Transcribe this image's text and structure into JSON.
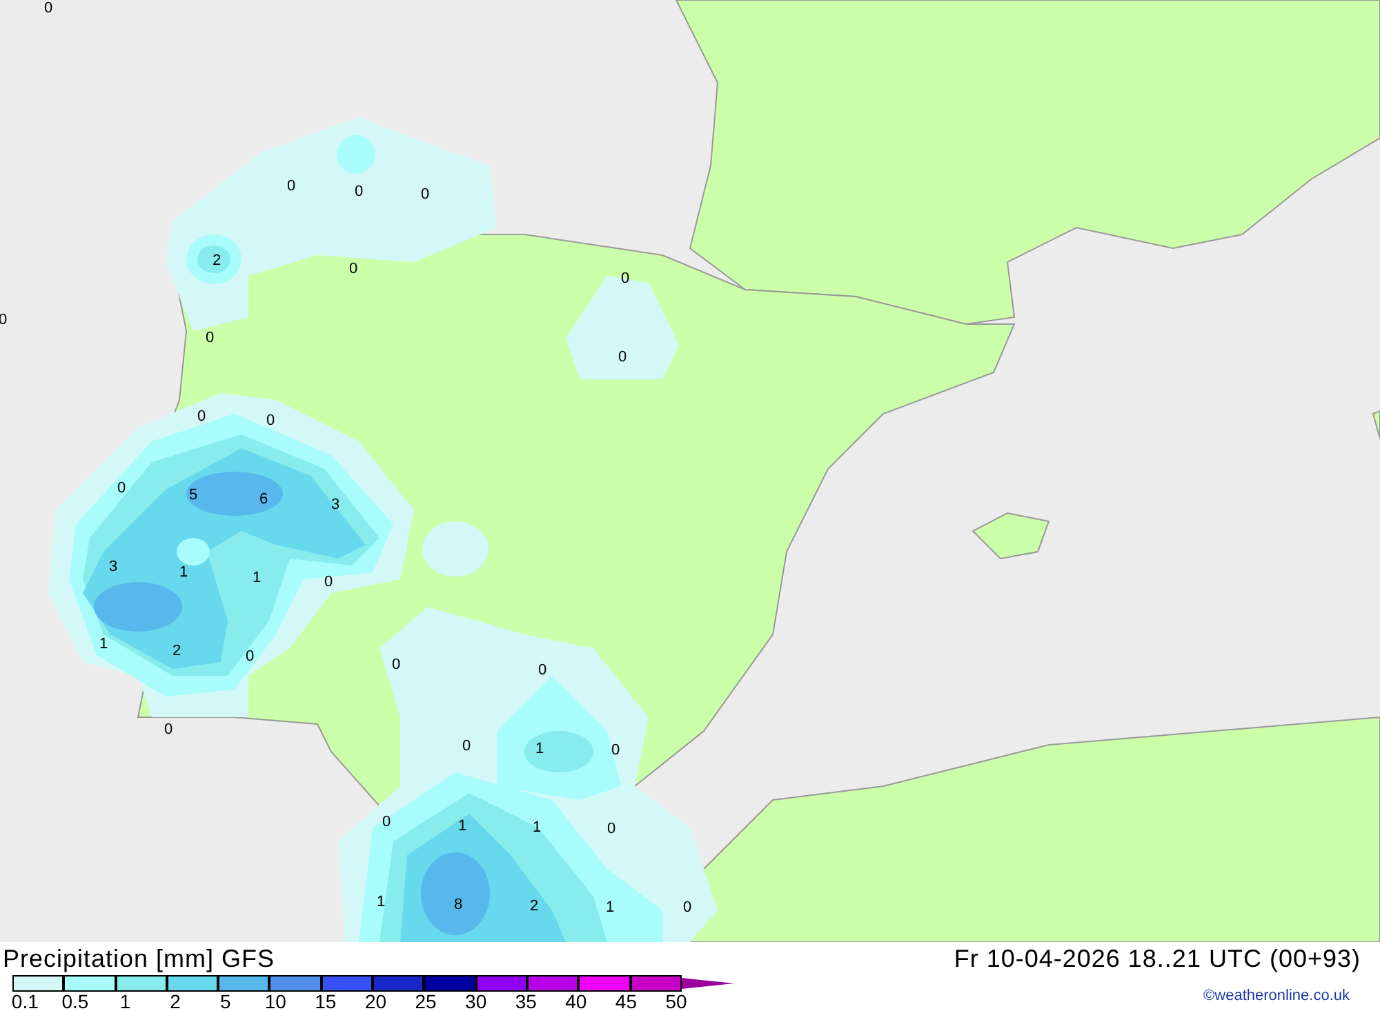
{
  "map": {
    "value_labels": [
      "0",
      "0",
      "0",
      "0",
      "2",
      "0",
      "0",
      "0",
      "0",
      "0",
      "0",
      "0",
      "0",
      "5",
      "6",
      "3",
      "3",
      "1",
      "1",
      "0",
      "1",
      "2",
      "0",
      "0",
      "0",
      "0",
      "0",
      "1",
      "0",
      "0",
      "1",
      "1",
      "0",
      "1",
      "8",
      "2",
      "1",
      "0"
    ]
  },
  "legend": {
    "title": "Precipitation [mm] GFS",
    "bins": [
      {
        "color": "#d4f8f8"
      },
      {
        "color": "#a8fcfc"
      },
      {
        "color": "#88ecec"
      },
      {
        "color": "#68d8ec"
      },
      {
        "color": "#58b8ec"
      },
      {
        "color": "#5090ec"
      },
      {
        "color": "#3850f8"
      },
      {
        "color": "#1828c8"
      },
      {
        "color": "#0000a0"
      },
      {
        "color": "#9000f8"
      },
      {
        "color": "#b800e8"
      },
      {
        "color": "#f000f8"
      },
      {
        "color": "#c800c8"
      }
    ],
    "overflow": {
      "color": "#9c009c"
    },
    "ticks": [
      "0.1",
      "0.5",
      "1",
      "2",
      "5",
      "10",
      "15",
      "20",
      "25",
      "30",
      "35",
      "40",
      "45",
      "50"
    ]
  },
  "valid_time": "Fr 10-04-2026 18..21 UTC (00+93)",
  "credit": "©weatheronline.co.uk"
}
